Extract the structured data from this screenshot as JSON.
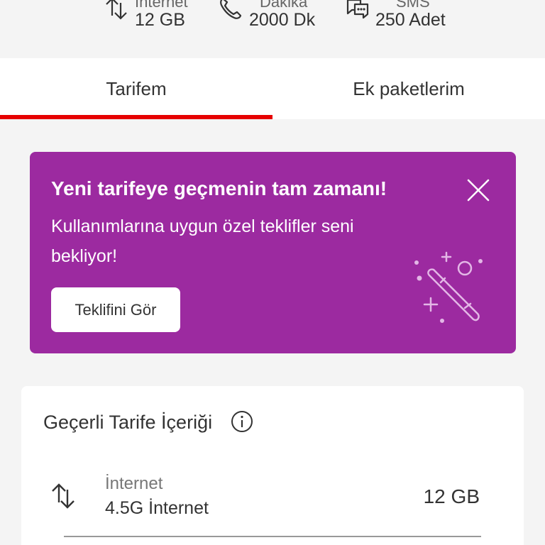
{
  "summary": {
    "items": [
      {
        "icon": "internet-arrows-icon",
        "label": "İnternet",
        "value": "12 GB"
      },
      {
        "icon": "phone-icon",
        "label": "Dakika",
        "value": "2000 Dk"
      },
      {
        "icon": "sms-bubble-icon",
        "label": "SMS",
        "value": "250 Adet"
      }
    ]
  },
  "tabs": [
    {
      "label": "Tarifem",
      "active": true
    },
    {
      "label": "Ek paketlerim",
      "active": false
    }
  ],
  "promo": {
    "title": "Yeni tarifeye geçmenin tam zamanı!",
    "text": "Kullanımlarına uygun özel teklifler seni bekliyor!",
    "button_label": "Teklifini Gör",
    "background": "#9c2aa0"
  },
  "tariff": {
    "title": "Geçerli Tarife İçeriği",
    "rows": [
      {
        "icon": "internet-arrows-icon",
        "label": "İnternet",
        "sub": "4.5G İnternet",
        "value": "12 GB"
      }
    ]
  },
  "colors": {
    "accent": "#e60000",
    "promo": "#9c2aa0"
  }
}
